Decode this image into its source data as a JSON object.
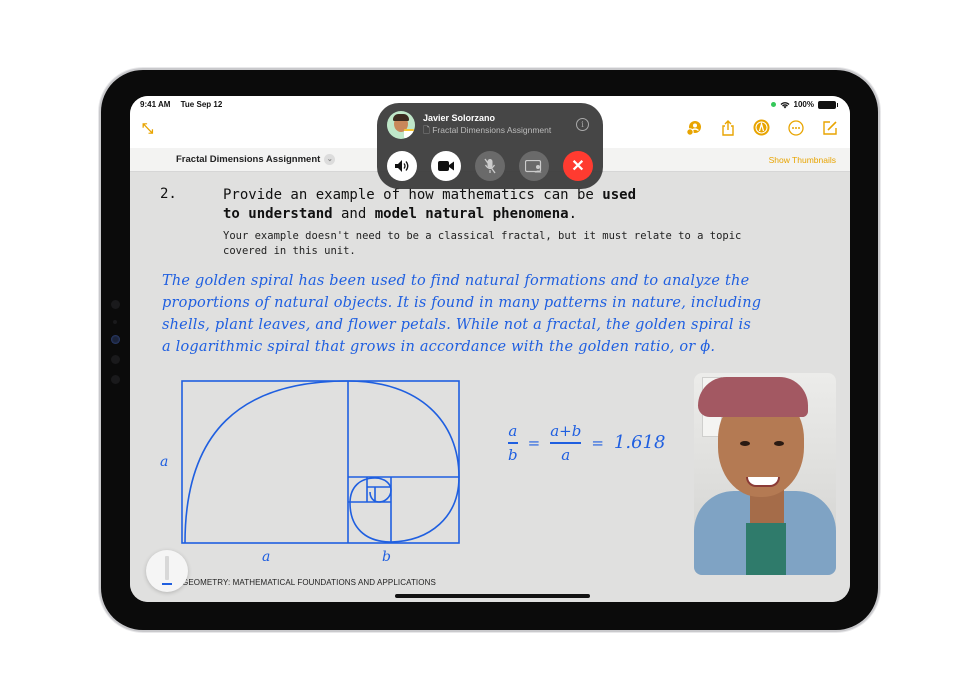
{
  "status_bar": {
    "time": "9:41 AM",
    "date": "Tue Sep 12",
    "battery": "100%",
    "icons": [
      "wifi-icon",
      "battery-icon"
    ]
  },
  "toolbar": {
    "collapse_icon": "collapse-arrows-icon",
    "right_icons": [
      "collaborate-icon",
      "share-icon",
      "markup-icon",
      "more-icon",
      "compose-icon"
    ]
  },
  "document_bar": {
    "title": "Fractal Dimensions Assignment",
    "show_thumbnails": "Show Thumbnails"
  },
  "facetime": {
    "caller_name": "Javier Solorzano",
    "shared_doc": "Fractal Dimensions Assignment",
    "buttons": [
      {
        "name": "speaker",
        "glyph": "🔊"
      },
      {
        "name": "camera",
        "glyph": "■"
      },
      {
        "name": "mute",
        "glyph": "🎙"
      },
      {
        "name": "shareplay",
        "glyph": "▭"
      },
      {
        "name": "end-call",
        "glyph": "✕"
      }
    ]
  },
  "question": {
    "number": "2.",
    "text_plain_1": "Provide an example of how mathematics can be ",
    "text_bold_1": "used",
    "text_bold_2": "to understand",
    "text_plain_2": " and ",
    "text_bold_3": "model natural phenomena",
    "text_plain_3": ".",
    "subtext": "Your example doesn't need to be a classical fractal, but it must relate to a topic covered in this unit."
  },
  "handwritten_answer": [
    "The golden spiral has been used to find natural formations and to analyze the",
    "proportions of natural objects. It is found in many patterns in nature, including",
    "shells, plant leaves, and flower petals. While not a fractal, the golden spiral is",
    "a logarithmic spiral that grows in accordance with the golden ratio, or ϕ."
  ],
  "diagram": {
    "label_side": "a",
    "label_bottom_a": "a",
    "label_bottom_b": "b"
  },
  "equation": {
    "frac1_num": "a",
    "frac1_den": "b",
    "eq1": "=",
    "frac2_num": "a+b",
    "frac2_den": "a",
    "eq2": "=",
    "value": "1.618"
  },
  "footer": "AL GEOMETRY: MATHEMATICAL FOUNDATIONS AND APPLICATIONS",
  "colors": {
    "accent": "#e8a400",
    "ink": "#1f5fe0",
    "end_call": "#ff3b30"
  }
}
